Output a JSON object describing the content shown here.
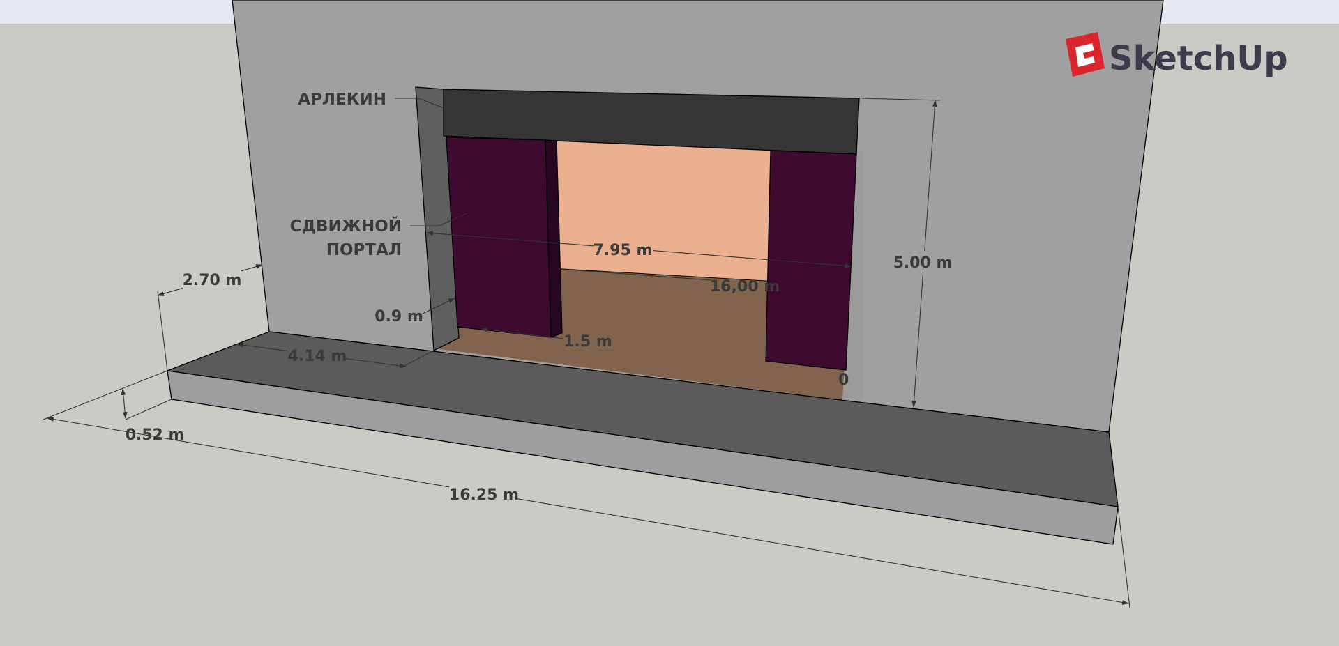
{
  "app": {
    "logo_text": "SketchUp"
  },
  "labels": {
    "arlekin": "АРЛЕКИН",
    "portal_line1": "СДВИЖНОЙ",
    "portal_line2": "ПОРТАЛ"
  },
  "dimensions": {
    "wall_depth": "2.70 m",
    "stage_height": "0.52 m",
    "stage_width": "16.25 m",
    "apron_depth": "4.14 m",
    "portal_thickness": "0.9 m",
    "portal_opening_width": "7.95 m",
    "portal_opening_height": "5.00 m",
    "stage_depth": "16,00 m",
    "curtain_width": "1.5 m",
    "clipped_dimension": "0"
  },
  "colors": {
    "sky": "#e3e9ef",
    "ground": "#cbcbc6",
    "wall": "#a0a0a0",
    "stage_top": "#5b5b5b",
    "stage_front": "#9e9e9e",
    "arlekin": "#353535",
    "portal_side": "#5f5f5f",
    "curtain": "#3e0a30",
    "back_wall": "#ebb08f",
    "floor": "#82634d",
    "logo_red": "#d9262c"
  }
}
